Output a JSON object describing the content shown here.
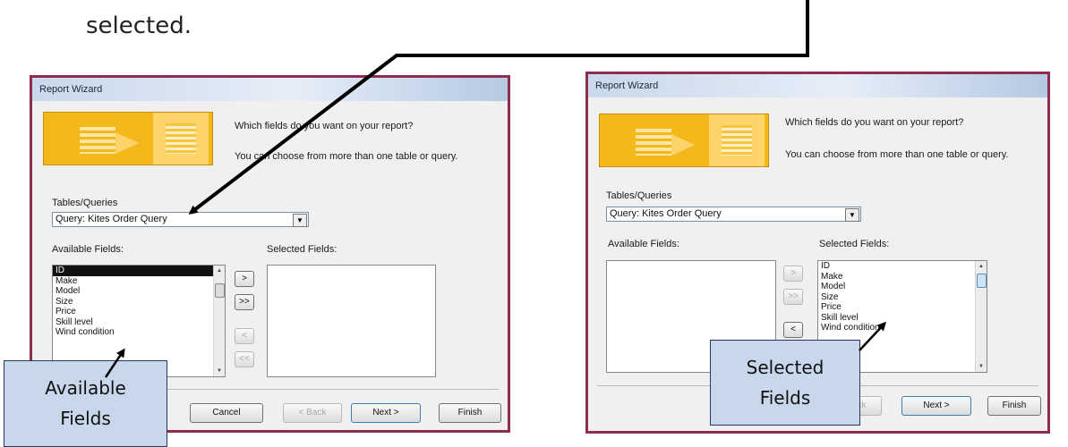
{
  "heading": "selected.",
  "left_wizard": {
    "title": "Report Wizard",
    "question": "Which fields do you want on your report?",
    "hint": "You can choose from more than one table or query.",
    "tables_label": "Tables/Queries",
    "tables_value": "Query: Kites Order Query",
    "available_label": "Available Fields:",
    "selected_label": "Selected Fields:",
    "available_fields": [
      "ID",
      "Make",
      "Model",
      "Size",
      "Price",
      "Skill level",
      "Wind condition"
    ],
    "selected_fields": [],
    "buttons": {
      "add_one": ">",
      "add_all": ">>",
      "remove_one": "<",
      "remove_all": "<<",
      "cancel": "Cancel",
      "back": "< Back",
      "next": "Next >",
      "finish": "Finish"
    }
  },
  "right_wizard": {
    "title": "Report Wizard",
    "question": "Which fields do you want on your report?",
    "hint": "You can choose from more than one table or query.",
    "tables_label": "Tables/Queries",
    "tables_value": "Query: Kites Order Query",
    "available_label": "Available Fields:",
    "selected_label": "Selected Fields:",
    "available_fields": [],
    "selected_fields": [
      "ID",
      "Make",
      "Model",
      "Size",
      "Price",
      "Skill level",
      "Wind condition"
    ],
    "buttons": {
      "add_one": ">",
      "add_all": ">>",
      "remove_one": "<",
      "back": "< Back",
      "next": "Next >",
      "finish": "Finish"
    }
  },
  "callout_left": {
    "line1": "Available",
    "line2": "Fields"
  },
  "callout_right": {
    "line1": "Selected",
    "line2": "Fields"
  },
  "colors": {
    "frame_border": "#8e2c52",
    "callout_fill": "#c8d7eb",
    "graphic": "#f4b81a"
  }
}
